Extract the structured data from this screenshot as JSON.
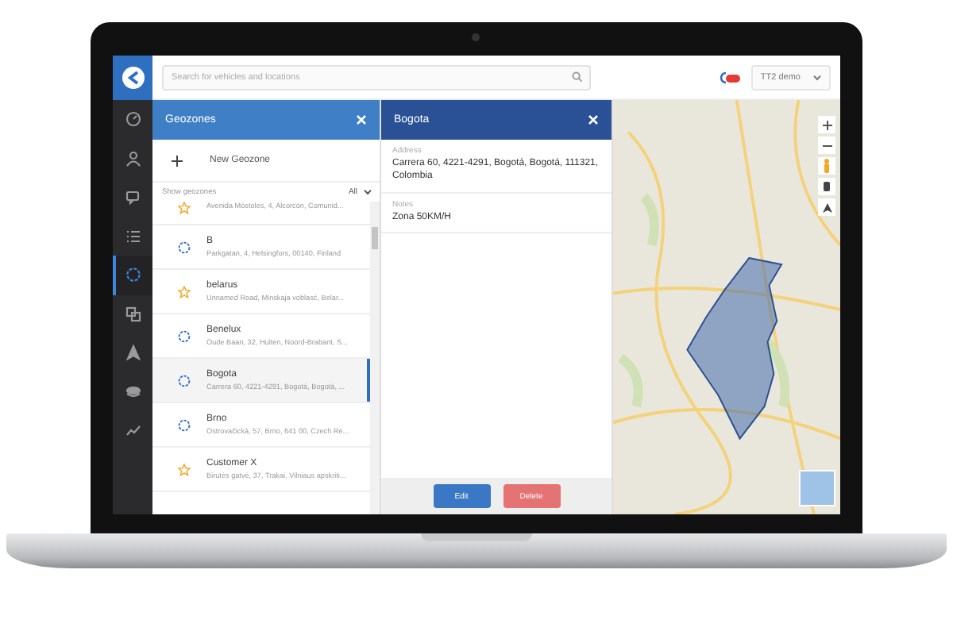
{
  "sidebar": {
    "items": [
      {
        "kind": "gauge",
        "selected": false
      },
      {
        "kind": "user",
        "selected": false
      },
      {
        "kind": "chat",
        "selected": false
      },
      {
        "kind": "list",
        "selected": false
      },
      {
        "kind": "geozone",
        "selected": true
      },
      {
        "kind": "shapes",
        "selected": false
      },
      {
        "kind": "navigate",
        "selected": false
      },
      {
        "kind": "stack",
        "selected": false
      },
      {
        "kind": "chart",
        "selected": false
      }
    ]
  },
  "top_bar": {
    "search": {
      "placeholder": "Search for vehicles and locations"
    },
    "account": "TT2 demo"
  },
  "geozones_panel": {
    "title": "Geozones",
    "new_button": "New Geozone",
    "filter_label": "Show geozones",
    "filter_value": "All",
    "items": [
      {
        "kind": "star",
        "address": "Avenida Móstoles, 4, Alcorcón, Comunid...",
        "selected": false
      },
      {
        "kind": "zone",
        "name": "B",
        "address": "Parkgatan, 4, Helsingfors, 00140, Finland",
        "selected": false
      },
      {
        "kind": "star",
        "name": "belarus",
        "address": "Unnamed Road, Minskaja voblasć, Belar...",
        "selected": false
      },
      {
        "kind": "zone",
        "name": "Benelux",
        "address": "Oude Baan, 32, Hulten, Noord-Brabant, S...",
        "selected": false
      },
      {
        "kind": "zone",
        "name": "Bogota",
        "address": "Carrera 60, 4221-4291, Bogotá, Bogotá, ...",
        "selected": true
      },
      {
        "kind": "zone",
        "name": "Brno",
        "address": "Ostrovačická, 57, Brno, 641 00, Czech Re...",
        "selected": false
      },
      {
        "kind": "star",
        "name": "Customer X",
        "address": "Birutės gatvė, 37, Trakai, Vilniaus apskriti...",
        "selected": false
      }
    ]
  },
  "detail_panel": {
    "title": "Bogota",
    "fields": [
      {
        "label": "Address",
        "value": "Carrera 60, 4221-4291, Bogotá, Bogotá, 111321, Colombia"
      },
      {
        "label": "Notes",
        "value": "Zona 50KM/H"
      }
    ],
    "buttons": [
      {
        "label": "Edit",
        "kind": "primary"
      },
      {
        "label": "Delete",
        "kind": "danger"
      }
    ]
  }
}
